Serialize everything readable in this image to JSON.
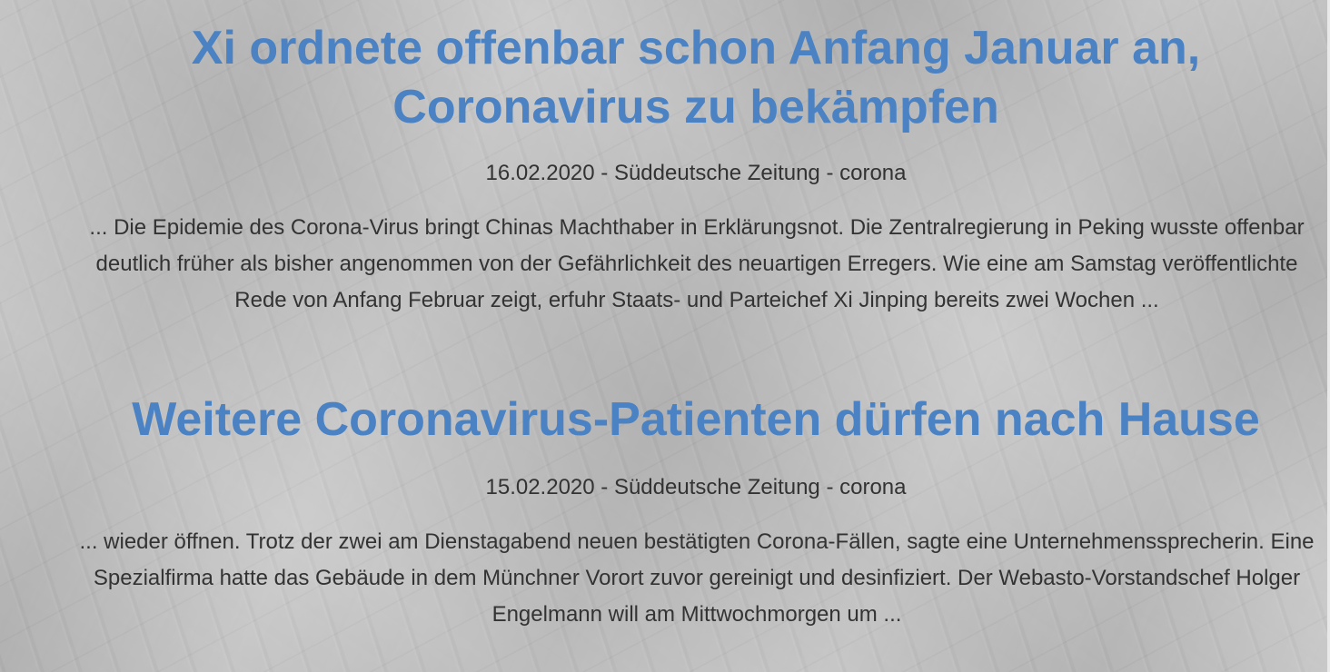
{
  "articles": [
    {
      "title": "Xi ordnete offenbar schon Anfang Januar an, Coronavirus zu bekämpfen",
      "meta": "16.02.2020 - Süddeutsche Zeitung - corona",
      "excerpt": "... Die Epidemie des Corona-Virus bringt Chinas Machthaber in Erklärungsnot. Die Zentralregierung in Peking wusste offenbar deutlich früher als bisher angenommen von der Gefährlichkeit des neuartigen Erregers. Wie eine am Samstag veröffentlichte Rede von Anfang Februar zeigt, erfuhr Staats- und Parteichef Xi Jinping bereits zwei Wochen ..."
    },
    {
      "title": "Weitere Coronavirus-Patienten dürfen nach Hause",
      "meta": "15.02.2020 - Süddeutsche Zeitung - corona",
      "excerpt": "... wieder öffnen. Trotz der zwei am Dienstagabend neuen bestätigten Corona-Fällen, sagte eine Unternehmenssprecherin. Eine Spezialfirma hatte das Gebäude in dem Münchner Vorort zuvor gereinigt und desinfiziert. Der Webasto-Vorstandschef Holger Engelmann will am Mittwochmorgen um ..."
    }
  ],
  "colors": {
    "title": "#4a82c4",
    "text": "#333333",
    "background": "#c4c4c4"
  }
}
